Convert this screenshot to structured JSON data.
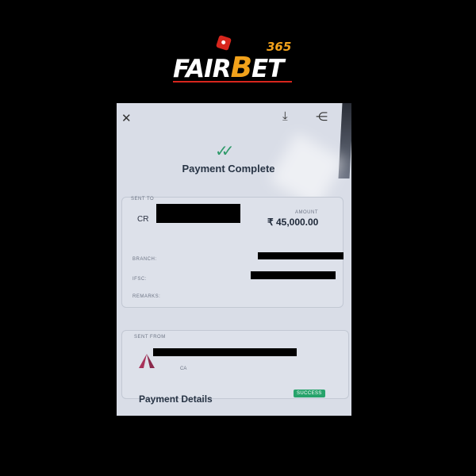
{
  "brand": {
    "name_part1": "FAIR",
    "name_b": "B",
    "name_part2": "ET",
    "superscript": "365"
  },
  "header": {
    "close_icon": "close-icon",
    "download_icon": "download-icon",
    "share_icon": "share-icon"
  },
  "status": {
    "title": "Payment Complete",
    "icon": "check-icon"
  },
  "sent_to": {
    "label": "SENT TO",
    "name_prefix": "CR",
    "amount_label": "AMOUNT",
    "amount": "₹ 45,000.00",
    "branch_label": "BRANCH:",
    "ifsc_label": "IFSC:",
    "remarks_label": "REMARKS:"
  },
  "sent_from": {
    "label": "SENT FROM",
    "account_type": "CA"
  },
  "payment_details": {
    "title": "Payment Details",
    "status_badge": "SUCCESS"
  },
  "colors": {
    "accent_green": "#27a36b",
    "brand_orange": "#f2a21b",
    "brand_red": "#d7261d"
  }
}
